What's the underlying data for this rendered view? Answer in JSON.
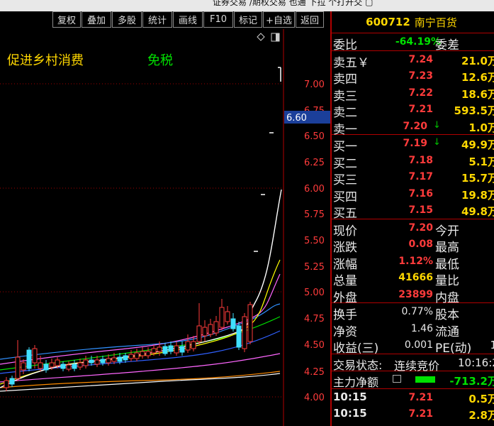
{
  "topbar_text": "证券交易  /期权交易  也通  下拉  个打开交  ▢",
  "toolbar": [
    "复权",
    "叠加",
    "多股",
    "统计",
    "画线",
    "F10",
    "标记",
    "+自选",
    "返回"
  ],
  "slogans": [
    {
      "text": "促进乡村消费",
      "color": "#ffd700"
    },
    {
      "text": "免税",
      "color": "#00e000"
    }
  ],
  "chart": {
    "price_axis": [
      "7.00",
      "6.75",
      "6.50",
      "6.25",
      "6.00",
      "5.75",
      "5.50",
      "5.25",
      "5.00",
      "4.75",
      "4.50",
      "4.25",
      "4.00"
    ],
    "current_price_label": "6.60",
    "ylim": [
      4.0,
      7.0
    ]
  },
  "stock": {
    "code": "600712",
    "name": "南宁百货"
  },
  "weibi": {
    "label": "委比",
    "value": "-64.19%",
    "label2": "委差"
  },
  "sell": [
    {
      "label": "卖五￥",
      "price": "7.24",
      "vol": "21.0万"
    },
    {
      "label": "卖四",
      "price": "7.23",
      "vol": "12.6万"
    },
    {
      "label": "卖三",
      "price": "7.22",
      "vol": "18.6万"
    },
    {
      "label": "卖二",
      "price": "7.21",
      "vol": "593.5万"
    },
    {
      "label": "卖一",
      "price": "7.20",
      "vol": "1.0万",
      "arrow": "↓"
    }
  ],
  "buy": [
    {
      "label": "买一",
      "price": "7.19",
      "vol": "49.9万",
      "arrow": "↓"
    },
    {
      "label": "买二",
      "price": "7.18",
      "vol": "5.1万"
    },
    {
      "label": "买三",
      "price": "7.17",
      "vol": "15.7万"
    },
    {
      "label": "买四",
      "price": "7.16",
      "vol": "19.8万"
    },
    {
      "label": "买五",
      "price": "7.15",
      "vol": "49.8万"
    }
  ],
  "quote": [
    {
      "label": "现价",
      "value": "7.20",
      "color": "red",
      "label2": "今开"
    },
    {
      "label": "涨跌",
      "value": "0.08",
      "color": "red",
      "label2": "最高"
    },
    {
      "label": "涨幅",
      "value": "1.12%",
      "color": "red",
      "label2": "最低"
    },
    {
      "label": "总量",
      "value": "41666",
      "color": "yel",
      "label2": "量比"
    },
    {
      "label": "外盘",
      "value": "23899",
      "color": "red",
      "label2": "内盘"
    }
  ],
  "stats": [
    {
      "label": "换手",
      "value": "0.77%",
      "label2": "股本"
    },
    {
      "label": "净资",
      "value": "1.46",
      "label2": "流通"
    },
    {
      "label": "收益(三)",
      "value": "0.001",
      "label2": "PE(动)",
      "extra": "1"
    }
  ],
  "status": {
    "label": "交易状态:",
    "value": "连续竞价",
    "time": "10:16:2"
  },
  "mainflow": {
    "label": "主力净额",
    "value": "-713.2万"
  },
  "ticks": [
    {
      "time": "10:15",
      "price": "7.21",
      "vol": "0.5万"
    },
    {
      "time": "10:15",
      "price": "7.21",
      "vol": "2.8万"
    }
  ]
}
